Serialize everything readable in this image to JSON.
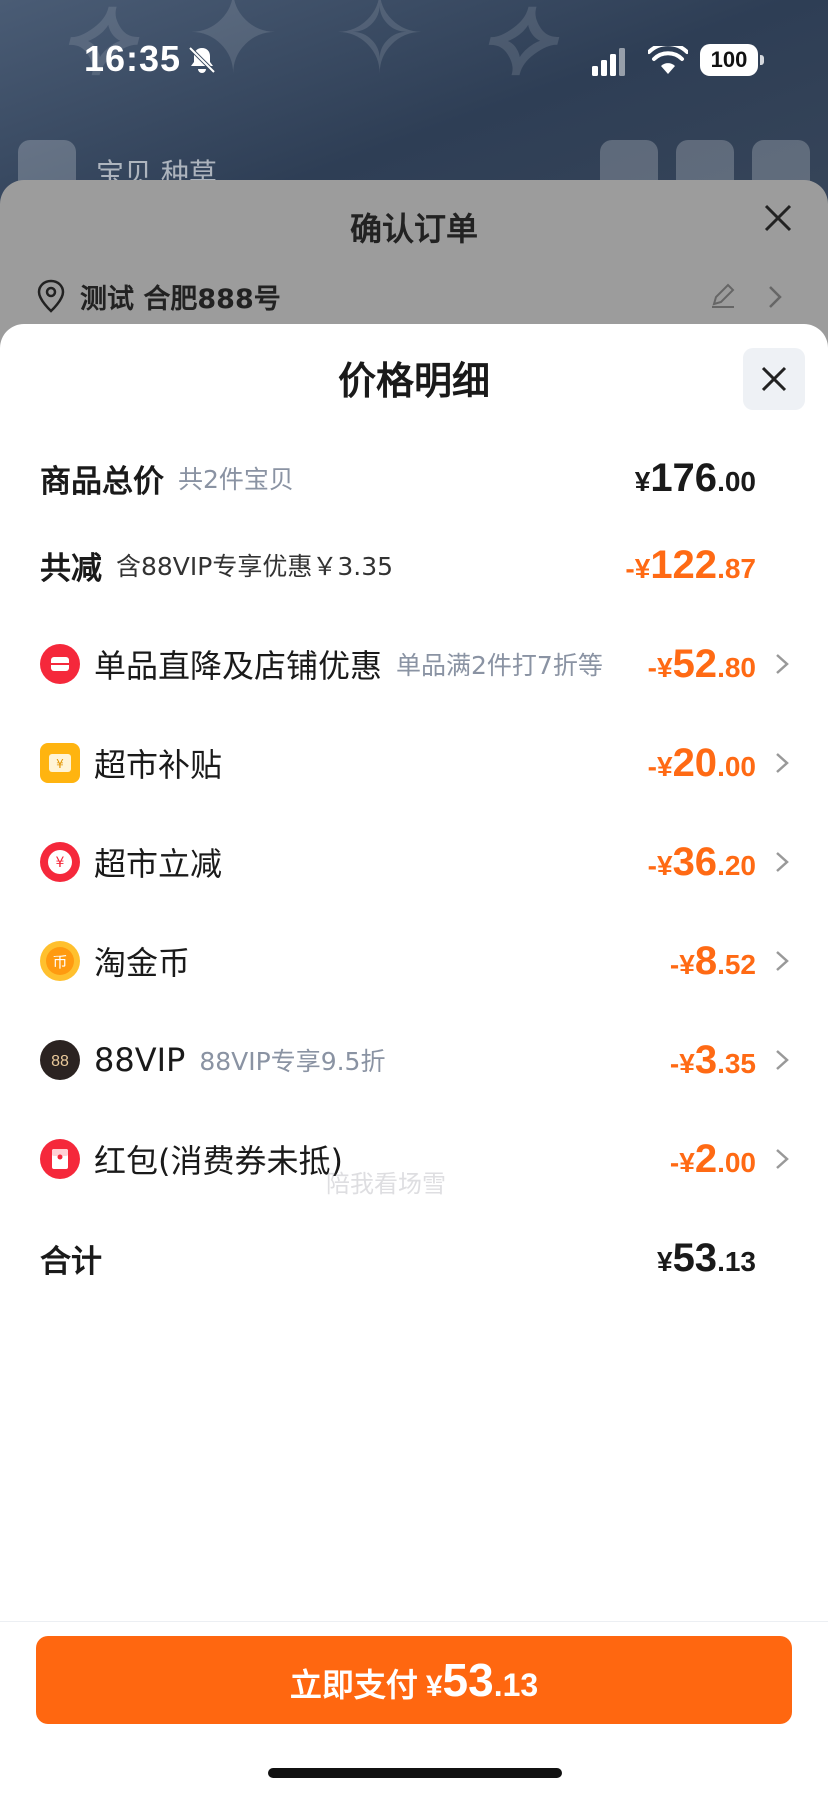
{
  "status_bar": {
    "time": "16:35",
    "battery": "100",
    "icons": [
      "bell-off-icon",
      "signal-icon",
      "wifi-icon",
      "battery-icon"
    ]
  },
  "background": {
    "nav_title": "宝贝 种草"
  },
  "confirm_order": {
    "title": "确认订单",
    "address": "测试 合肥888号"
  },
  "price_detail": {
    "title": "价格明细",
    "rows": [
      {
        "label": "商品总价",
        "sub": "共2件宝贝",
        "sign": "",
        "int": "176",
        "dec": ".00",
        "type": "neutral"
      },
      {
        "label": "共减",
        "sub": "含88VIP专享优惠￥3.35",
        "sign": "-",
        "int": "122",
        "dec": ".87",
        "type": "discount"
      },
      {
        "label": "单品直降及店铺优惠",
        "sub": "单品满2件打7折等",
        "sign": "-",
        "int": "52",
        "dec": ".80",
        "type": "discount",
        "icon": "store-coupon-icon"
      },
      {
        "label": "超市补贴",
        "sub": "",
        "sign": "-",
        "int": "20",
        "dec": ".00",
        "type": "discount",
        "icon": "subsidy-icon"
      },
      {
        "label": "超市立减",
        "sub": "",
        "sign": "-",
        "int": "36",
        "dec": ".20",
        "type": "discount",
        "icon": "yuan-discount-icon"
      },
      {
        "label": "淘金币",
        "sub": "",
        "sign": "-",
        "int": "8",
        "dec": ".52",
        "type": "discount",
        "icon": "gold-coin-icon"
      },
      {
        "label": "88VIP",
        "sub": "88VIP专享9.5折",
        "sign": "-",
        "int": "3",
        "dec": ".35",
        "type": "discount",
        "icon": "vip88-icon"
      },
      {
        "label": "红包(消费券未抵)",
        "sub": "",
        "sign": "-",
        "int": "2",
        "dec": ".00",
        "type": "discount",
        "icon": "red-packet-icon"
      },
      {
        "label": "合计",
        "sub": "",
        "sign": "",
        "int": "53",
        "dec": ".13",
        "type": "neutral"
      }
    ],
    "currency": "¥",
    "watermark": "陪我看场雪"
  },
  "pay_button": {
    "label": "立即支付",
    "currency": "¥",
    "int": "53",
    "dec": ".13"
  },
  "colors": {
    "accent": "#ff6710",
    "discount": "#ff6a14",
    "text": "#1a1a1a",
    "muted": "#8a93a3"
  }
}
